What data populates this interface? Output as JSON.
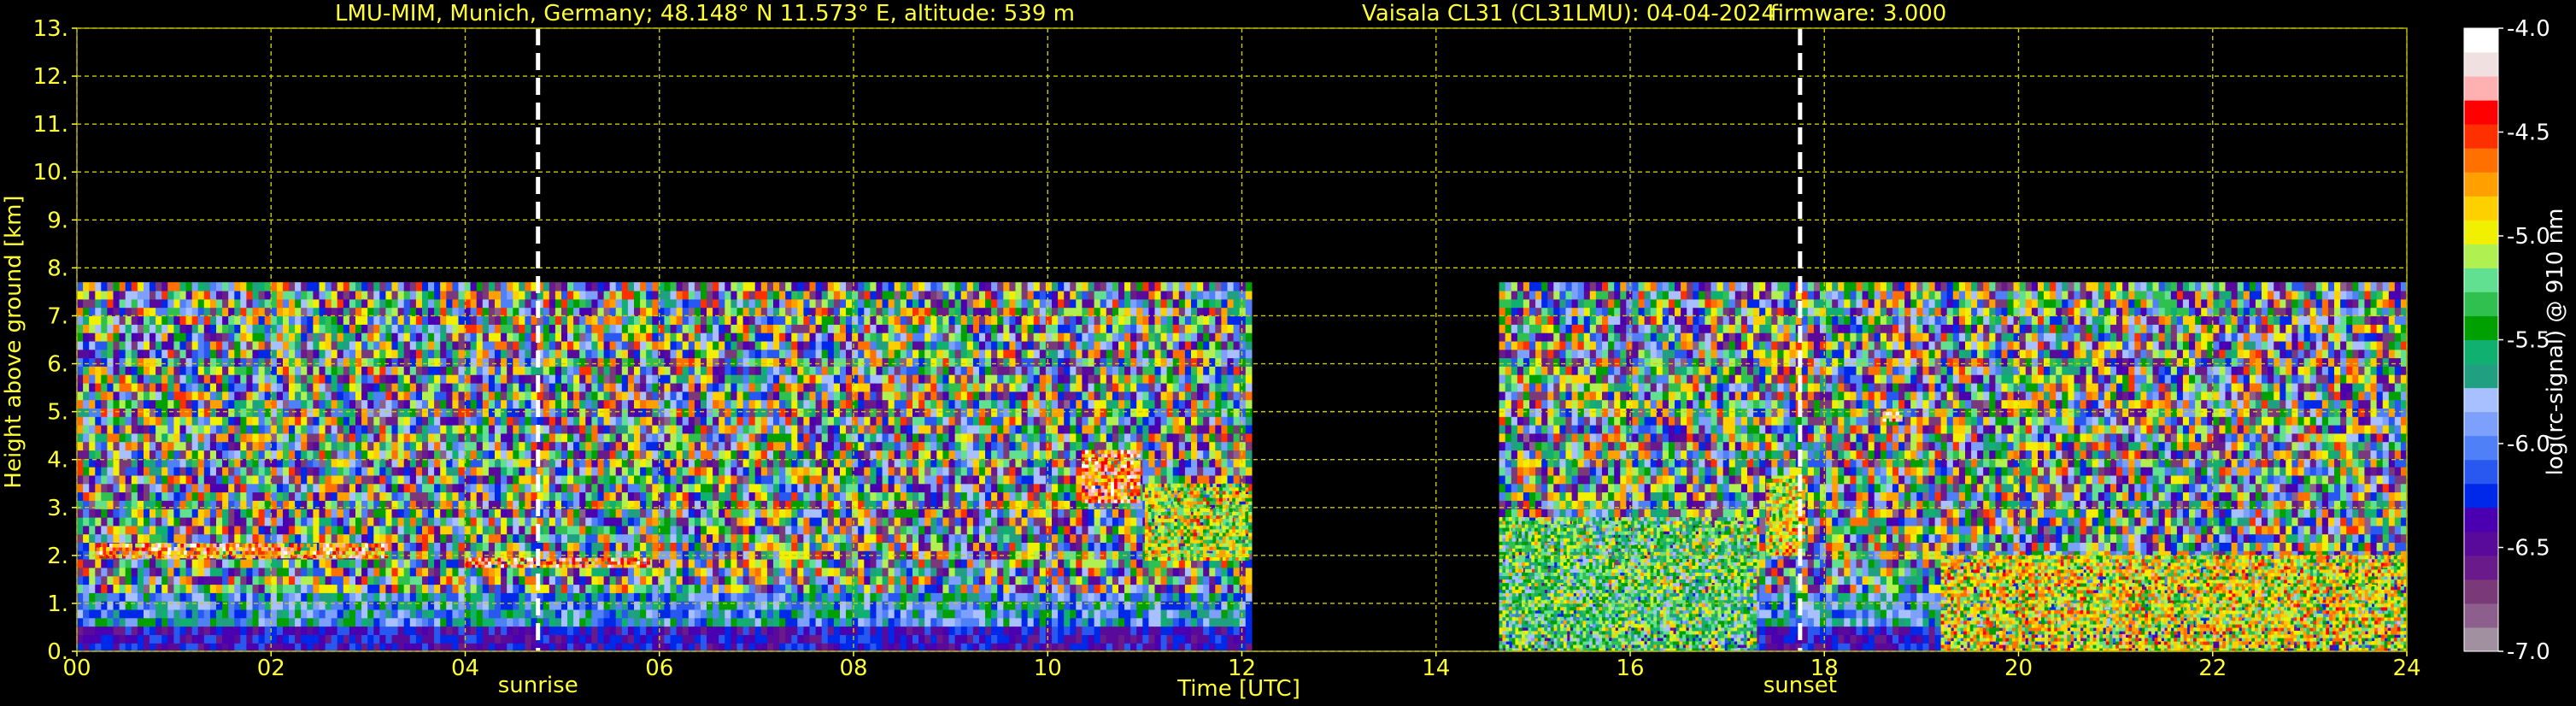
{
  "chart_data": {
    "type": "heatmap",
    "title_parts": [
      "LMU-MIM, Munich, Germany; 48.148° N 11.573° E, altitude: 539 m",
      "Vaisala CL31 (CL31LMU): 04-04-2024",
      "firmware: 3.000"
    ],
    "xlabel": "Time [UTC]",
    "ylabel": "Height above ground [km]",
    "xlim": [
      0,
      24
    ],
    "ylim": [
      0,
      13
    ],
    "x_ticks": [
      {
        "v": 0,
        "label": "00"
      },
      {
        "v": 2,
        "label": "02"
      },
      {
        "v": 4,
        "label": "04"
      },
      {
        "v": 6,
        "label": "06"
      },
      {
        "v": 8,
        "label": "08"
      },
      {
        "v": 10,
        "label": "10"
      },
      {
        "v": 12,
        "label": "12"
      },
      {
        "v": 14,
        "label": "14"
      },
      {
        "v": 16,
        "label": "16"
      },
      {
        "v": 18,
        "label": "18"
      },
      {
        "v": 20,
        "label": "20"
      },
      {
        "v": 22,
        "label": "22"
      },
      {
        "v": 24,
        "label": "24"
      }
    ],
    "y_ticks": [
      {
        "v": 0,
        "label": "0."
      },
      {
        "v": 1,
        "label": "1."
      },
      {
        "v": 2,
        "label": "2."
      },
      {
        "v": 3,
        "label": "3."
      },
      {
        "v": 4,
        "label": "4."
      },
      {
        "v": 5,
        "label": "5."
      },
      {
        "v": 6,
        "label": "6."
      },
      {
        "v": 7,
        "label": "7."
      },
      {
        "v": 8,
        "label": "8."
      },
      {
        "v": 9,
        "label": "9."
      },
      {
        "v": 10,
        "label": "10."
      },
      {
        "v": 11,
        "label": "11."
      },
      {
        "v": 12,
        "label": "12."
      },
      {
        "v": 13,
        "label": "13."
      }
    ],
    "grid": true,
    "markers": [
      {
        "name": "sunrise",
        "x": 4.75
      },
      {
        "name": "sunset",
        "x": 17.75
      }
    ],
    "data_periods": [
      {
        "start": 0.0,
        "end": 12.1,
        "top_km": 7.7
      },
      {
        "start": 14.65,
        "end": 24.0,
        "top_km": 7.7
      }
    ],
    "features": [
      {
        "kind": "cloud_layer",
        "x_start": 0.2,
        "x_end": 3.2,
        "y_low": 1.95,
        "y_high": 2.25,
        "value": -4.2
      },
      {
        "kind": "cloud_layer",
        "x_start": 4.0,
        "x_end": 5.9,
        "y_low": 1.75,
        "y_high": 1.95,
        "value": -4.2
      },
      {
        "kind": "cloud_patch",
        "x_start": 10.35,
        "x_end": 10.95,
        "y_low": 3.1,
        "y_high": 4.2,
        "value": -4.2
      },
      {
        "kind": "cloud_patch",
        "x_start": 11.0,
        "x_end": 12.1,
        "y_low": 1.9,
        "y_high": 3.5,
        "value": -4.7
      },
      {
        "kind": "boundary_layer",
        "x_start": 14.65,
        "x_end": 17.3,
        "y_low": 0.0,
        "y_high": 2.8,
        "value": -5.0
      },
      {
        "kind": "cloud_patch",
        "x_start": 17.4,
        "x_end": 17.8,
        "y_low": 2.0,
        "y_high": 3.6,
        "value": -4.6
      },
      {
        "kind": "precip_band",
        "x_start": 19.2,
        "x_end": 24.0,
        "y_low": 0.0,
        "y_high": 2.0,
        "value": -4.6
      },
      {
        "kind": "cloud_patch",
        "x_start": 18.6,
        "x_end": 18.8,
        "y_low": 4.8,
        "y_high": 5.0,
        "value": -4.2
      }
    ],
    "colorbar": {
      "label": "log(rc-signal) @ 910 nm",
      "min": -7.0,
      "max": -4.0,
      "ticks": [
        {
          "v": -4.0,
          "label": "-4.0"
        },
        {
          "v": -4.5,
          "label": "-4.5"
        },
        {
          "v": -5.0,
          "label": "-5.0"
        },
        {
          "v": -5.5,
          "label": "-5.5"
        },
        {
          "v": -6.0,
          "label": "-6.0"
        },
        {
          "v": -6.5,
          "label": "-6.5"
        },
        {
          "v": -7.0,
          "label": "-7.0"
        }
      ],
      "colors": [
        "#a090a0",
        "#8c5f8c",
        "#7a3a7a",
        "#6a1a8a",
        "#5a0a9a",
        "#4a00b0",
        "#0028e8",
        "#2858f0",
        "#5080f8",
        "#7ca0fc",
        "#a8c0ff",
        "#20a080",
        "#10b070",
        "#00a000",
        "#30c050",
        "#60e090",
        "#b0f050",
        "#f0f000",
        "#ffd000",
        "#ffa000",
        "#ff7000",
        "#ff3000",
        "#ff0000",
        "#ffb0b0",
        "#f0e0e0",
        "#ffffff"
      ]
    },
    "background_color": "#000000",
    "text_color": "#ffff33",
    "grid_color": "#cccc00",
    "marker_color": "#ffffff"
  }
}
